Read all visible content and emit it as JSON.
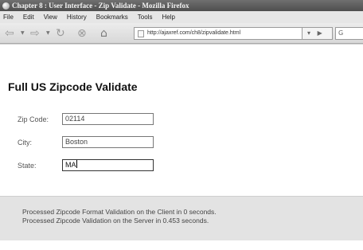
{
  "window": {
    "title": "Chapter 8 : User Interface - Zip Validate - Mozilla Firefox"
  },
  "menu": [
    "File",
    "Edit",
    "View",
    "History",
    "Bookmarks",
    "Tools",
    "Help"
  ],
  "nav": {
    "url": "http://ajaxref.com/ch8/zipvalidate.html",
    "search_engine": "G"
  },
  "page": {
    "title": "Full US Zipcode Validate",
    "fields": [
      {
        "label": "Zip Code:",
        "value": "02114"
      },
      {
        "label": "City:",
        "value": "Boston"
      },
      {
        "label": "State:",
        "value": "MA"
      }
    ],
    "status": [
      "Processed Zipcode Format Validation on the Client in 0 seconds.",
      "Processed Zipcode Validation on the Server in 0.453 seconds."
    ]
  }
}
